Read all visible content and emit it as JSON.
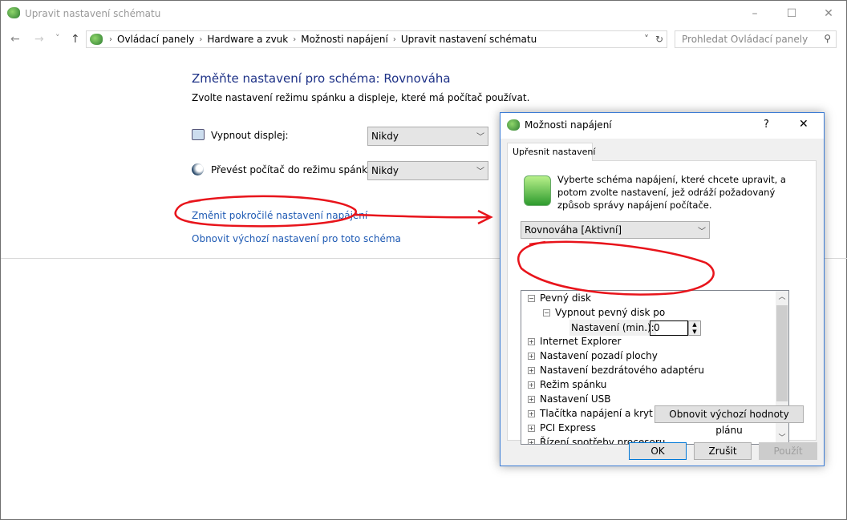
{
  "window": {
    "title": "Upravit nastavení schématu",
    "minimize": "–",
    "maximize": "☐",
    "close": "✕"
  },
  "nav": {
    "back": "←",
    "forward": "→",
    "recent": "˅",
    "up": "↑",
    "breadcrumb": [
      "Ovládací panely",
      "Hardware a zvuk",
      "Možnosti napájení",
      "Upravit nastavení schématu"
    ],
    "dropdown": "˅",
    "refresh": "↻",
    "search_placeholder": "Prohledat Ovládací panely",
    "search_icon": "⚲"
  },
  "main": {
    "heading": "Změňte nastavení pro schéma: Rovnováha",
    "subheading": "Zvolte nastavení režimu spánku a displeje, které má počítač používat.",
    "display_label": "Vypnout displej:",
    "display_value": "Nikdy",
    "sleep_label": "Převést počítač do režimu spánku:",
    "sleep_value": "Nikdy",
    "advanced_link": "Změnit pokročilé nastavení napájení",
    "restore_link": "Obnovit výchozí nastavení pro toto schéma"
  },
  "dialog": {
    "title": "Možnosti napájení",
    "help": "?",
    "close": "✕",
    "tab": "Upřesnit nastavení",
    "description": "Vyberte schéma napájení, které chcete upravit, a potom zvolte nastavení, jež odráží požadovaný způsob správy napájení počítače.",
    "scheme": "Rovnováha [Aktivní]",
    "tree": [
      {
        "label": "Pevný disk",
        "expanded": true
      },
      {
        "label": "Vypnout pevný disk po",
        "expanded": true
      },
      {
        "label": "Internet Explorer"
      },
      {
        "label": "Nastavení pozadí plochy"
      },
      {
        "label": "Nastavení bezdrátového adaptéru"
      },
      {
        "label": "Režim spánku"
      },
      {
        "label": "Nastavení USB"
      },
      {
        "label": "Tlačítka napájení a kryt"
      },
      {
        "label": "PCI Express"
      },
      {
        "label": "Řízení spotřeby procesoru"
      }
    ],
    "setting_label": "Nastavení (min.):",
    "setting_value": "0",
    "restore_button": "Obnovit výchozí hodnoty plánu",
    "ok": "OK",
    "cancel": "Zrušit",
    "apply": "Použít"
  },
  "colors": {
    "link": "#1e5ab4",
    "heading": "#1e3287",
    "annotation": "#e8141b",
    "dialog_border": "#3a7bd5"
  }
}
